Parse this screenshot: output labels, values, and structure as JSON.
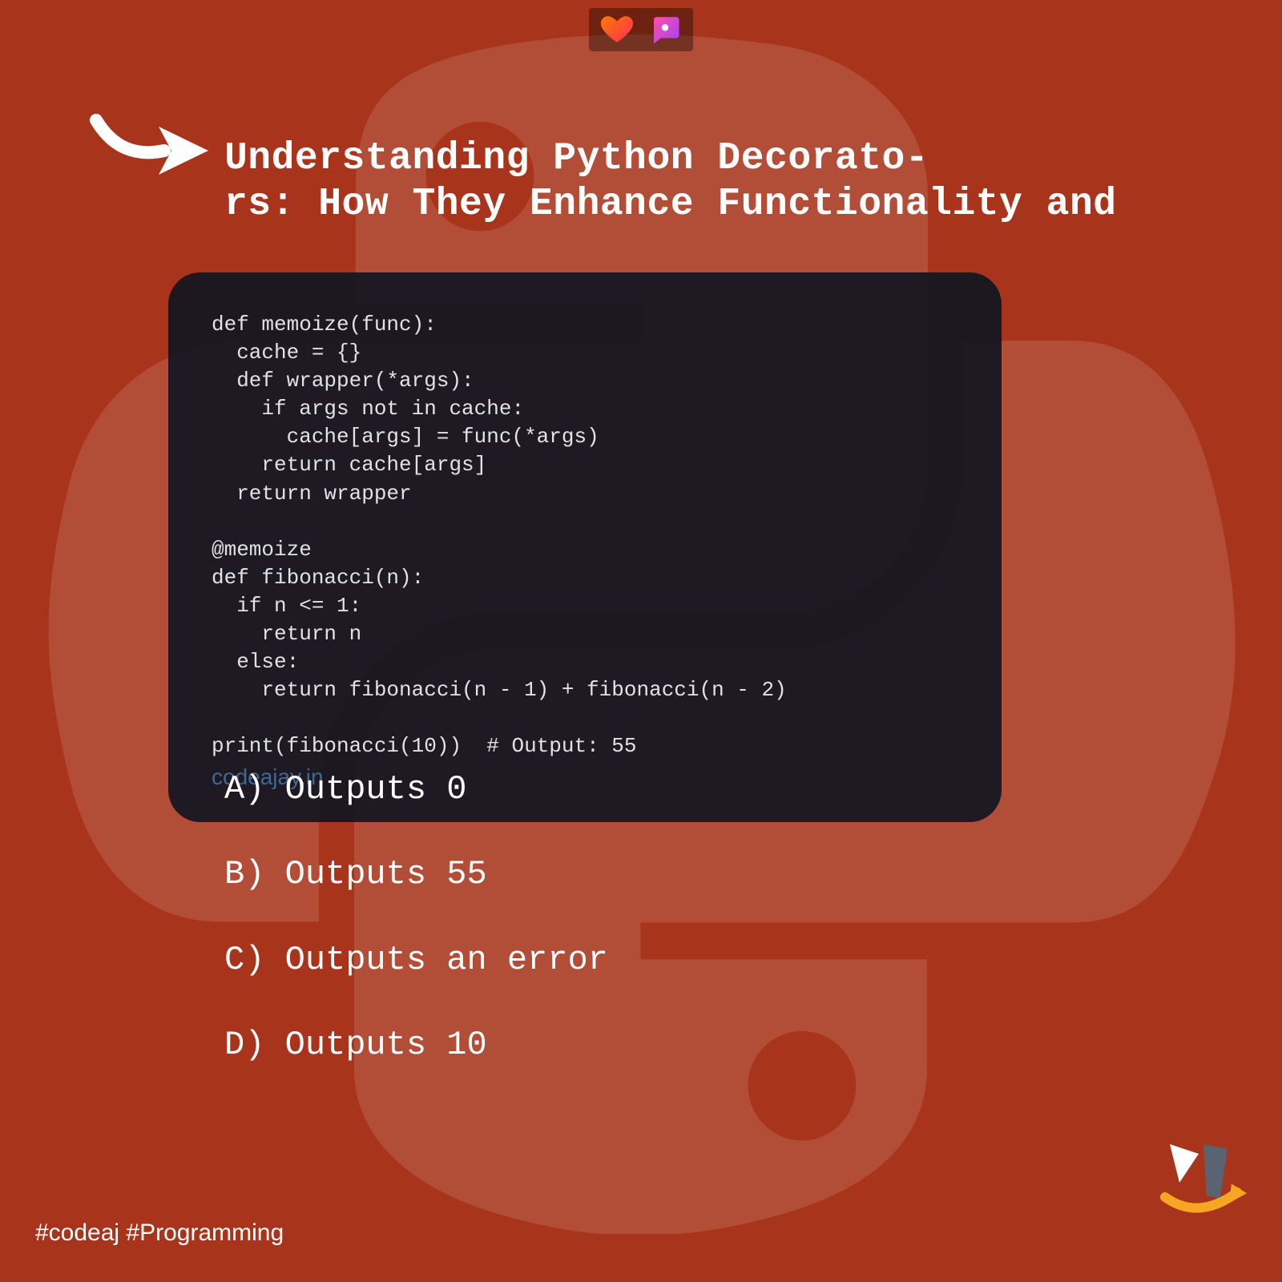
{
  "title": "Understanding Python Decorato-\nrs: How They Enhance Functionality and",
  "code": "def memoize(func):\n  cache = {}\n  def wrapper(*args):\n    if args not in cache:\n      cache[args] = func(*args)\n    return cache[args]\n  return wrapper\n\n@memoize\ndef fibonacci(n):\n  if n <= 1:\n    return n\n  else:\n    return fibonacci(n - 1) + fibonacci(n - 2)\n\nprint(fibonacci(10))  # Output: 55",
  "code_watermark": "codeajay.in",
  "options": {
    "a": "A) Outputs 0",
    "b": "B) Outputs 55",
    "c": "C) Outputs an error",
    "d": "D) Outputs 10"
  },
  "hashtags": "#codeaj #Programming",
  "icons": {
    "heart": "heart-icon",
    "comment": "comment-icon",
    "arrow": "arrow-right-icon",
    "python": "python-logo-icon",
    "brand": "brand-logo-icon"
  }
}
